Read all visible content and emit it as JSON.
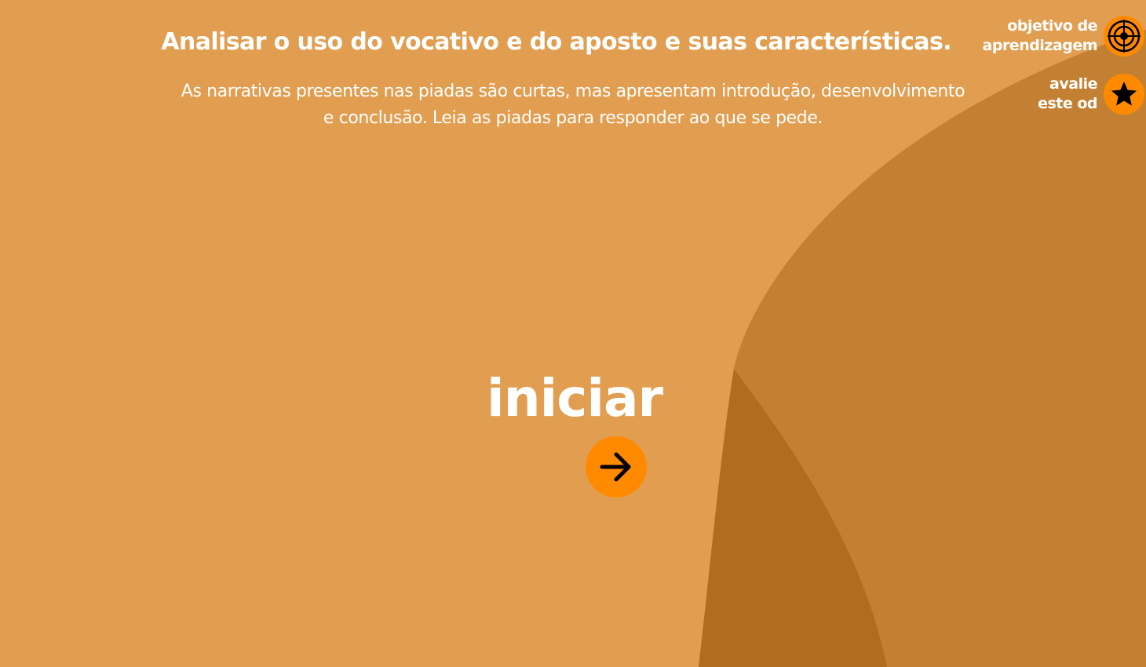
{
  "header": {
    "title": "Analisar o uso do vocativo e do aposto e suas características."
  },
  "intro": {
    "text": "As narrativas presentes nas piadas são curtas, mas apresentam introdução, desenvolvimento e conclusão. Leia as piadas para responder ao que se pede."
  },
  "side_menu": {
    "objetivo": {
      "line1": "objetivo de",
      "line2": "aprendizagem",
      "icon": "target-icon"
    },
    "avalie": {
      "line1": "avalie",
      "line2": "este od",
      "icon": "star-icon"
    }
  },
  "start": {
    "label": "iniciar",
    "icon": "arrow-right-icon"
  },
  "colors": {
    "background": "#e29e50",
    "wave_mid": "#c48032",
    "wave_dark": "#b06d20",
    "accent": "#ff8a00",
    "text": "#ffffff",
    "icon": "#000000"
  }
}
